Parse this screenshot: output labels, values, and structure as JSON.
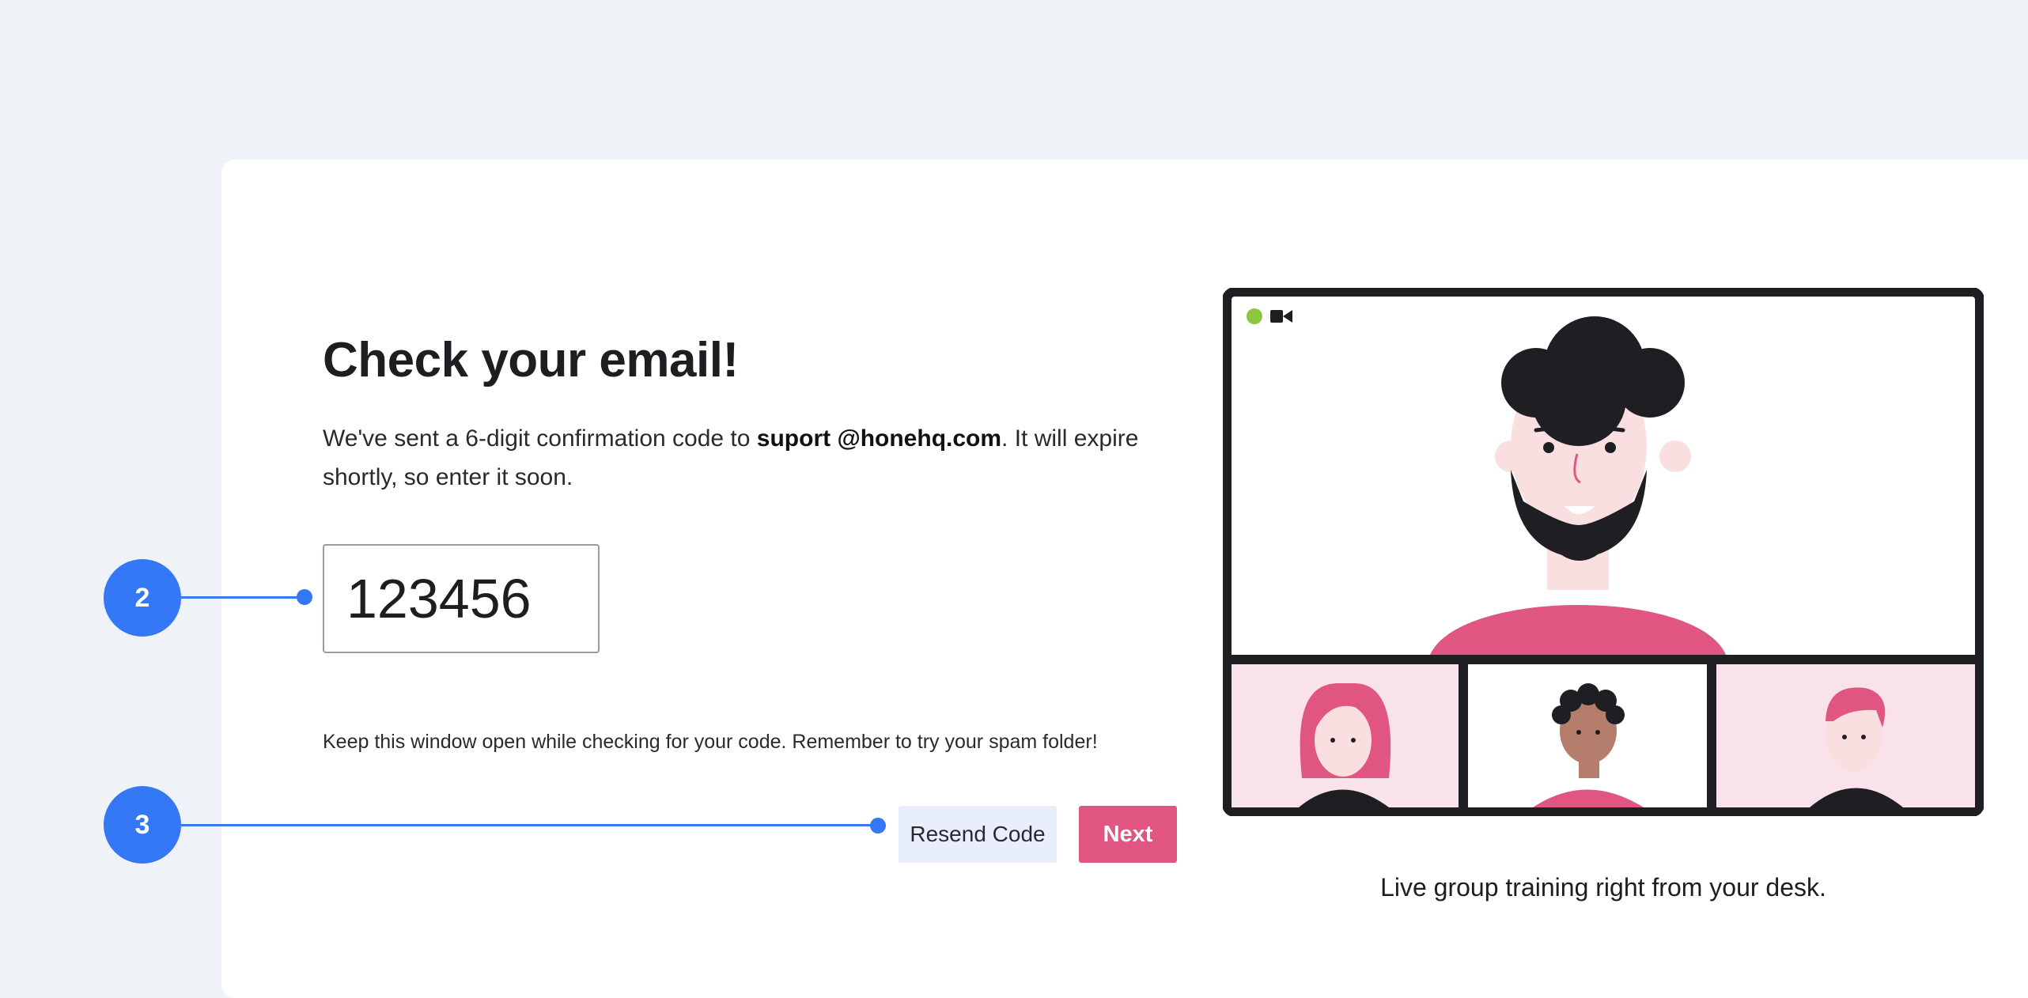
{
  "page": {
    "title": "Check your email!",
    "description_prefix": "We've sent a 6-digit confirmation code to ",
    "email": "suport @honehq.com",
    "description_suffix": ". It will expire shortly, so enter it soon.",
    "code_value": "123456",
    "hint": "Keep this window open while checking for your code. Remember to try your spam folder!",
    "resend_label": "Resend Code",
    "next_label": "Next"
  },
  "callouts": {
    "first": "2",
    "second": "3"
  },
  "illustration": {
    "caption": "Live group training right from your desk.",
    "status_icon": "green-dot-icon",
    "camera_icon": "video-camera-icon"
  },
  "colors": {
    "accent": "#e05680",
    "callout": "#3478f6",
    "page_bg": "#eff2f7",
    "resend_bg": "#e8eefc",
    "frame": "#1f1f23",
    "status_green": "#8dc63f"
  }
}
